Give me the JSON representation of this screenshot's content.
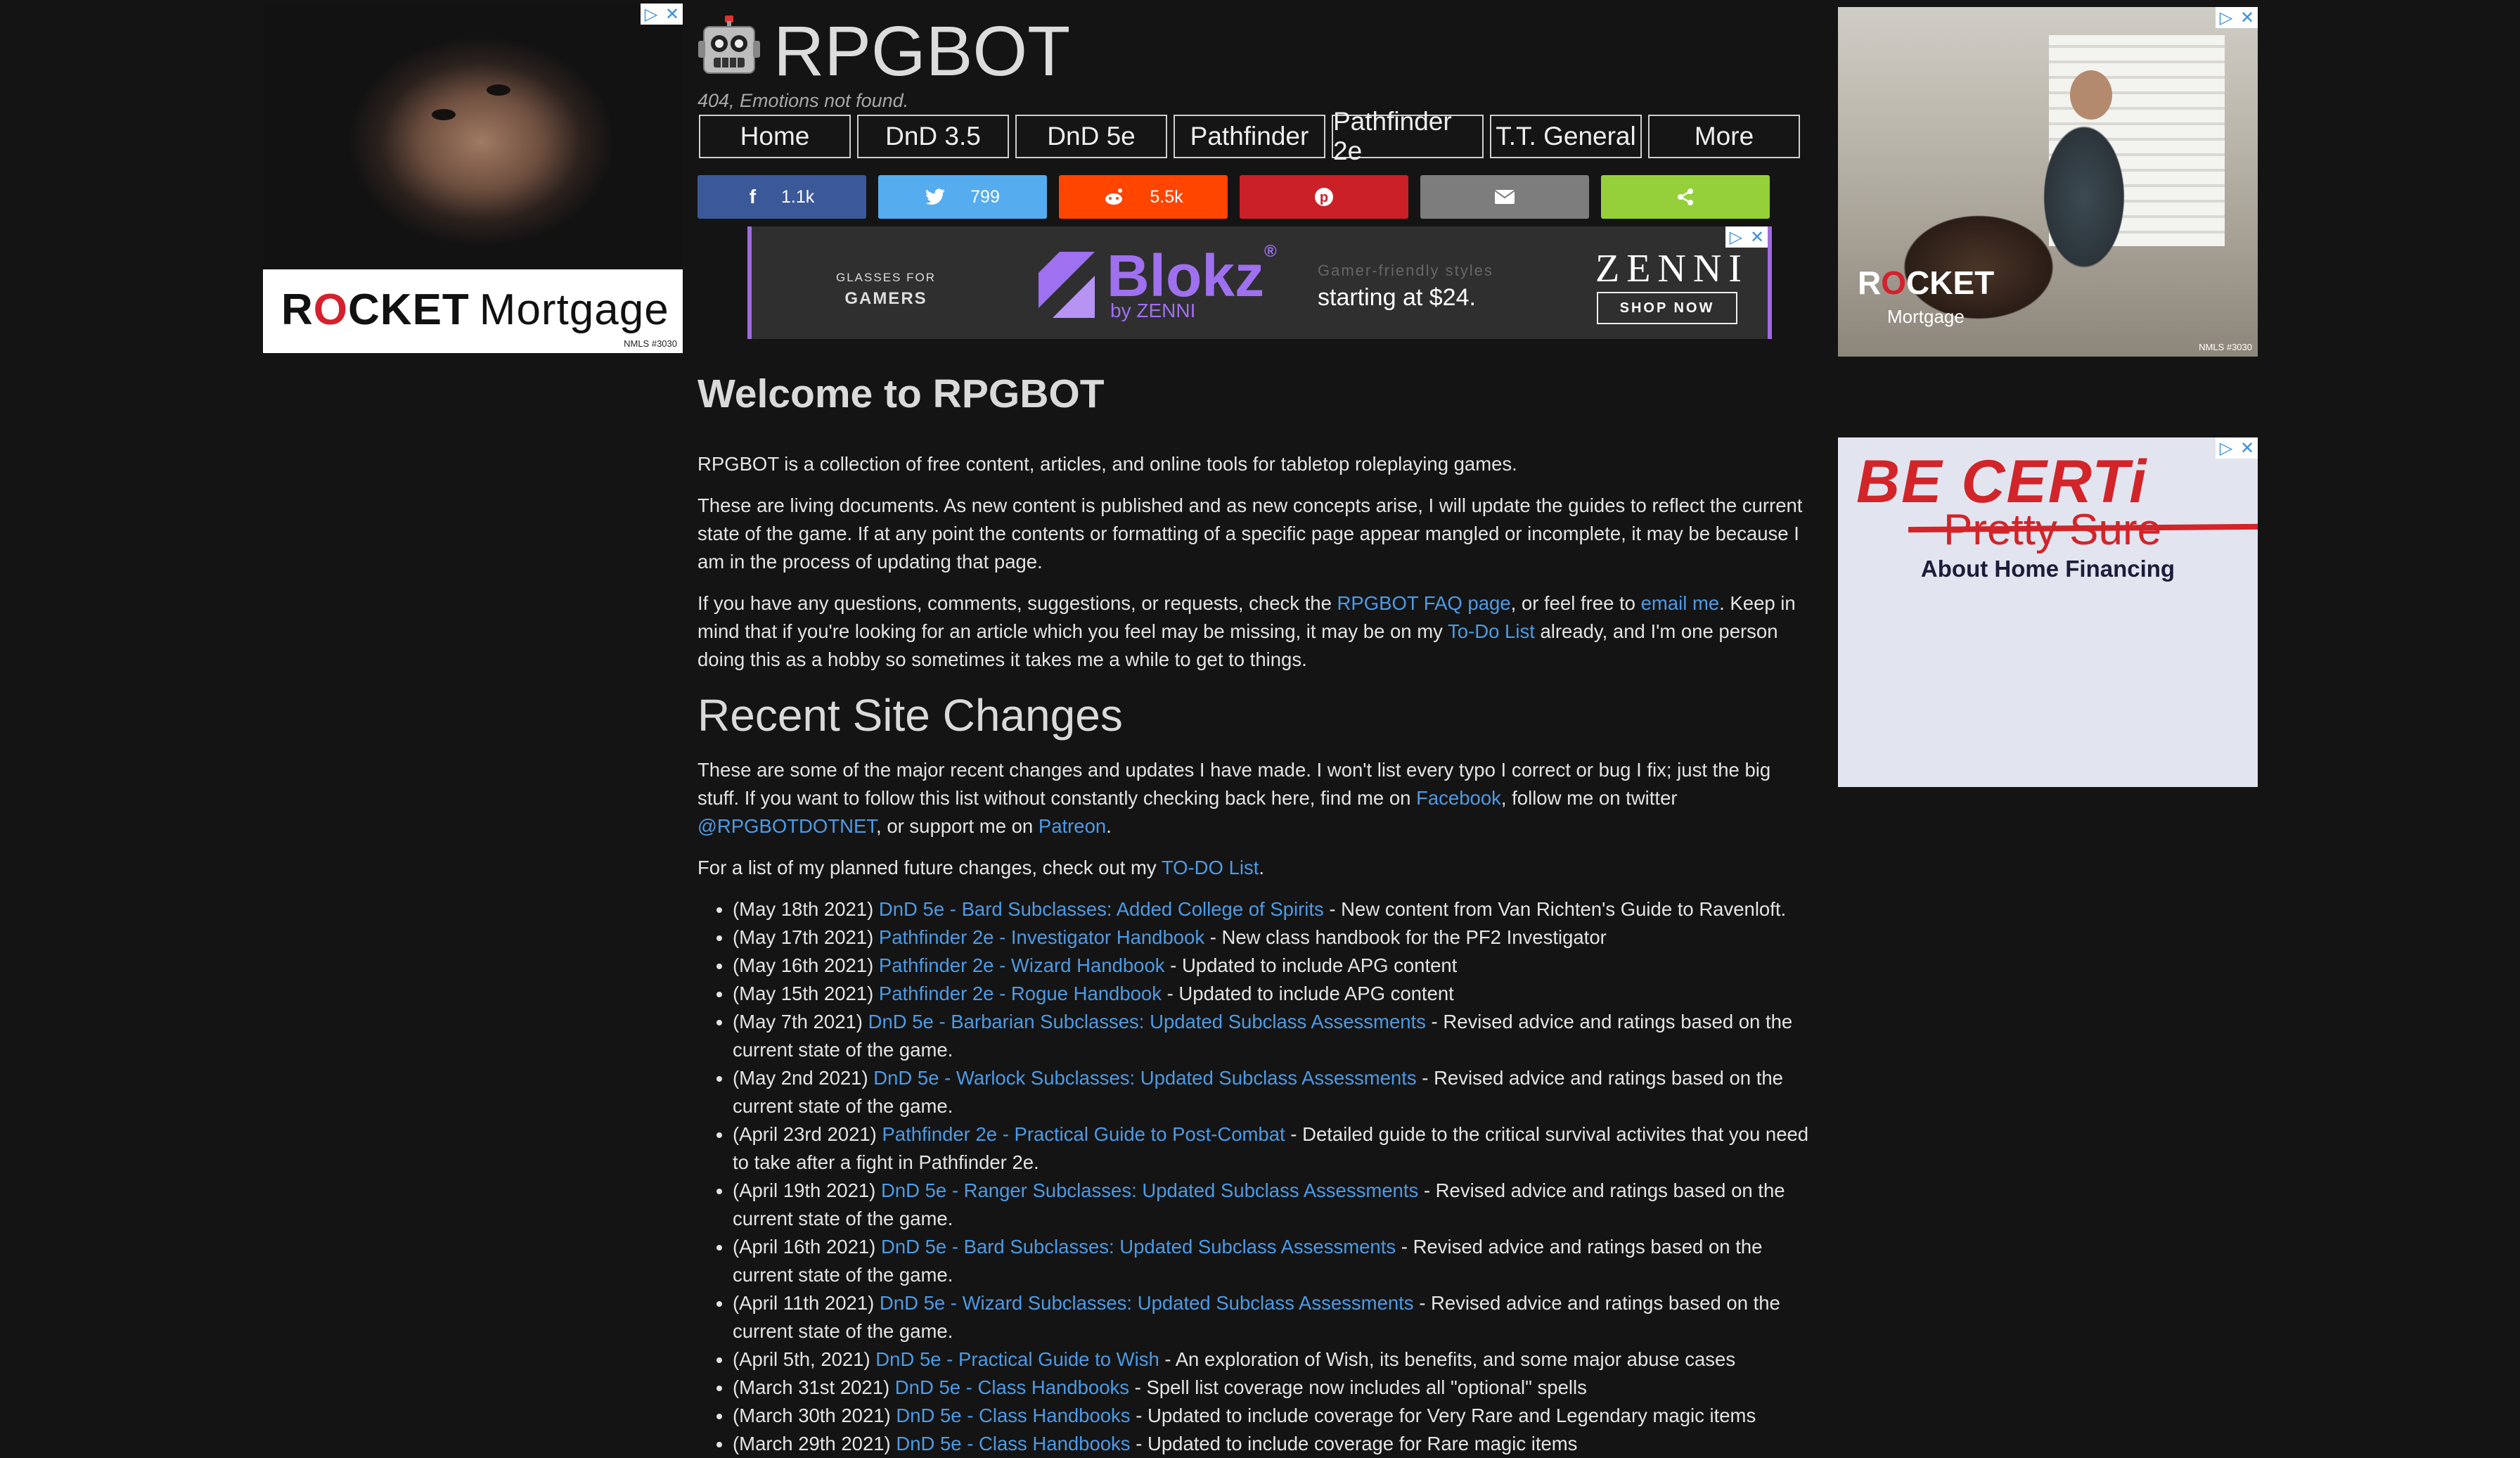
{
  "left_ad": {
    "brand_r": "R",
    "brand_o": "O",
    "brand_rest": "CKET",
    "brand_mortgage": "Mortgage",
    "nmls": "NMLS #3030"
  },
  "header": {
    "site_title": "RPGBOT",
    "tagline": "404, Emotions not found."
  },
  "nav": [
    {
      "label": "Home"
    },
    {
      "label": "DnD 3.5"
    },
    {
      "label": "DnD 5e"
    },
    {
      "label": "Pathfinder"
    },
    {
      "label": "Pathfinder 2e"
    },
    {
      "label": "T.T. General"
    },
    {
      "label": "More"
    }
  ],
  "share": {
    "facebook_count": "1.1k",
    "twitter_count": "799",
    "reddit_count": "5.5k",
    "colors": {
      "facebook": "#3b5998",
      "twitter": "#55acee",
      "reddit": "#ff4500",
      "pinterest": "#cb2027",
      "email": "#7d7d7d",
      "share": "#95d03a"
    }
  },
  "banner_ad": {
    "glasses_for": "GLASSES FOR",
    "gamers": "GAMERS",
    "blokz": "Blokz",
    "reg": "®",
    "by_zenni": "by ZENNI",
    "gamer_friendly": "Gamer-friendly styles",
    "starting_at": "starting at $24.",
    "zenni": "ZENNI",
    "shop_now": "SHOP NOW"
  },
  "right_ad_1": {
    "brand_r": "R",
    "brand_o": "O",
    "brand_rest": "CKET",
    "brand_mortgage": "Mortgage",
    "nmls": "NMLS #3030"
  },
  "right_ad_2": {
    "be_certain": "BE CERTi",
    "pretty_sure": "Pretty Sure",
    "about": "About Home Financing"
  },
  "main": {
    "welcome_title": "Welcome to RPGBOT",
    "intro": "RPGBOT is a collection of free content, articles, and online tools for tabletop roleplaying games.",
    "living_docs": "These are living documents. As new content is published and as new concepts arise, I will update the guides to reflect the current state of the game. If at any point the contents or formatting of a specific page appear mangled or incomplete, it may be because I am in the process of updating that page.",
    "questions_pre": "If you have any questions, comments, suggestions, or requests, check the ",
    "faq_link": "RPGBOT FAQ page",
    "questions_mid": ", or feel free to ",
    "email_link": "email me",
    "questions_mid2": ". Keep in mind that if you're looking for an article which you feel may be missing, it may be on my ",
    "todo_link": "To-Do List",
    "questions_post": " already, and I'm one person doing this as a hobby so sometimes it takes me a while to get to things.",
    "recent_title": "Recent Site Changes",
    "recent_pre": "These are some of the major recent changes and updates I have made. I won't list every typo I correct or bug I fix; just the big stuff. If you want to follow this list without constantly checking back here, find me on ",
    "facebook_link": "Facebook",
    "recent_mid": ", follow me on twitter ",
    "twitter_link": "@RPGBOTDOTNET",
    "recent_mid2": ", or support me on ",
    "patreon_link": "Patreon",
    "recent_post": ".",
    "planned_pre": "For a list of my planned future changes, check out my ",
    "planned_link": "TO-DO List",
    "planned_post": ".",
    "changes": [
      {
        "date": "(May 18th 2021) ",
        "link": "DnD 5e - Bard Subclasses: Added College of Spirits",
        "desc": " - New content from Van Richten's Guide to Ravenloft."
      },
      {
        "date": "(May 17th 2021) ",
        "link": "Pathfinder 2e - Investigator Handbook",
        "desc": " - New class handbook for the PF2 Investigator"
      },
      {
        "date": "(May 16th 2021) ",
        "link": "Pathfinder 2e - Wizard Handbook",
        "desc": " - Updated to include APG content"
      },
      {
        "date": "(May 15th 2021) ",
        "link": "Pathfinder 2e - Rogue Handbook",
        "desc": " - Updated to include APG content"
      },
      {
        "date": "(May 7th 2021) ",
        "link": "DnD 5e - Barbarian Subclasses: Updated Subclass Assessments",
        "desc": " - Revised advice and ratings based on the current state of the game."
      },
      {
        "date": "(May 2nd 2021) ",
        "link": "DnD 5e - Warlock Subclasses: Updated Subclass Assessments",
        "desc": " - Revised advice and ratings based on the current state of the game."
      },
      {
        "date": "(April 23rd 2021) ",
        "link": "Pathfinder 2e - Practical Guide to Post-Combat",
        "desc": " - Detailed guide to the critical survival activites that you need to take after a fight in Pathfinder 2e."
      },
      {
        "date": "(April 19th 2021) ",
        "link": "DnD 5e - Ranger Subclasses: Updated Subclass Assessments",
        "desc": " - Revised advice and ratings based on the current state of the game."
      },
      {
        "date": "(April 16th 2021) ",
        "link": "DnD 5e - Bard Subclasses: Updated Subclass Assessments",
        "desc": " - Revised advice and ratings based on the current state of the game."
      },
      {
        "date": "(April 11th 2021) ",
        "link": "DnD 5e - Wizard Subclasses: Updated Subclass Assessments",
        "desc": " - Revised advice and ratings based on the current state of the game."
      },
      {
        "date": "(April 5th, 2021) ",
        "link": "DnD 5e - Practical Guide to Wish",
        "desc": " - An exploration of Wish, its benefits, and some major abuse cases"
      },
      {
        "date": "(March 31st 2021) ",
        "link": "DnD 5e - Class Handbooks",
        "desc": " - Spell list coverage now includes all \"optional\" spells"
      },
      {
        "date": "(March 30th 2021) ",
        "link": "DnD 5e - Class Handbooks",
        "desc": " - Updated to include coverage for Very Rare and Legendary magic items"
      },
      {
        "date": "(March 29th 2021) ",
        "link": "DnD 5e - Class Handbooks",
        "desc": " - Updated to include coverage for Rare magic items"
      }
    ]
  }
}
